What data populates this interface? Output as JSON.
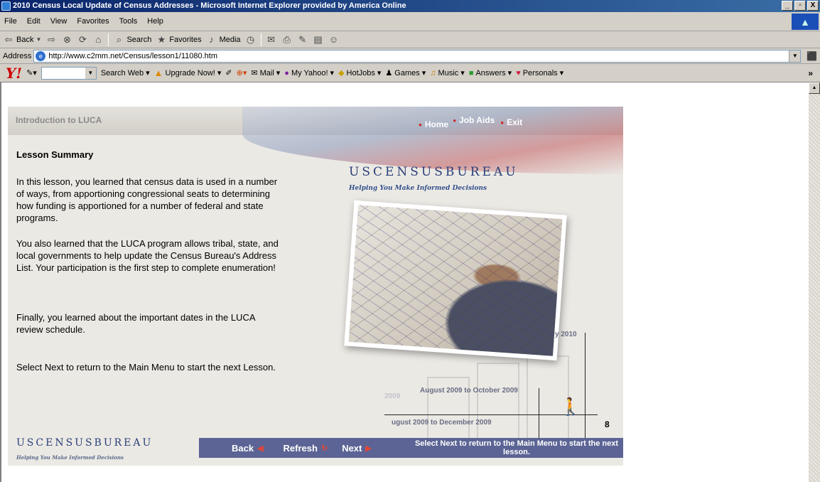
{
  "window": {
    "title": "2010 Census Local Update of Census Addresses - Microsoft Internet Explorer provided by America Online",
    "buttons": [
      "_",
      "▫",
      "X"
    ]
  },
  "menu": [
    "File",
    "Edit",
    "View",
    "Favorites",
    "Tools",
    "Help"
  ],
  "toolbar": {
    "back": "Back",
    "search": "Search",
    "favorites": "Favorites",
    "media": "Media"
  },
  "address": {
    "label": "Address",
    "url": "http://www.c2mm.net/Census/lesson1/11080.htm"
  },
  "yahoo": {
    "logo": "Y!",
    "search_web": "Search Web",
    "upgrade": "Upgrade Now!",
    "mail": "Mail",
    "my_yahoo": "My Yahoo!",
    "hotjobs": "HotJobs",
    "games": "Games",
    "music": "Music",
    "answers": "Answers",
    "personals": "Personals",
    "more": "»"
  },
  "lesson": {
    "header_title": "Introduction to LUCA",
    "nav": {
      "home": "Home",
      "job_aids": "Job Aids",
      "exit": "Exit"
    },
    "heading": "Lesson Summary",
    "paragraphs": [
      "In this lesson, you learned that census data is used in a number of ways, from apportioning congressional seats to determining how funding is apportioned for a number of federal and state programs.",
      "You also learned that the LUCA program allows tribal, state, and local governments to help update the Census Bureau's Address List.  Your participation is the first step to complete enumeration!",
      "Finally, you learned about the important dates in the LUCA review schedule.",
      "Select Next to return to the Main Menu to start the next Lesson."
    ],
    "bureau_logo": "USCENSUSBUREAU",
    "bureau_tagline": "Helping You Make Informed Decisions",
    "timeline": {
      "label_1": "y 2010",
      "label_2": "August 2009 to October 2009",
      "label_3": "ugust 2009 to December 2009",
      "label_faded": "2009"
    },
    "page_number": "8",
    "footer_logo": "USCENSUSBUREAU",
    "footer_tagline": "Helping You Make Informed Decisions",
    "navbar": {
      "back": "Back",
      "refresh": "Refresh",
      "next": "Next",
      "message": "Select Next to return to the Main Menu to start the next lesson."
    }
  }
}
